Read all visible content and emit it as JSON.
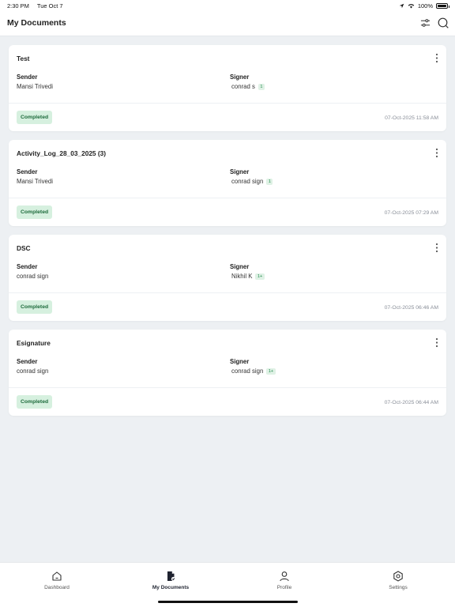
{
  "status_bar": {
    "time": "2:30 PM",
    "date": "Tue Oct 7",
    "battery": "100%"
  },
  "header": {
    "title": "My Documents",
    "filter_icon": "sliders-icon",
    "search_icon": "search-icon"
  },
  "labels": {
    "sender": "Sender",
    "signer": "Signer"
  },
  "documents": [
    {
      "title": "Test",
      "sender": "Mansi Trivedi",
      "signer": "conrad s",
      "signer_count": "1",
      "status": "Completed",
      "timestamp": "07-Oct-2025 11:58 AM"
    },
    {
      "title": "Activity_Log_28_03_2025 (3)",
      "sender": "Mansi Trivedi",
      "signer": "conrad sign",
      "signer_count": "1",
      "status": "Completed",
      "timestamp": "07-Oct-2025 07:29 AM"
    },
    {
      "title": "DSC",
      "sender": "conrad sign",
      "signer": "Nikhil K",
      "signer_count": "1+",
      "status": "Completed",
      "timestamp": "07-Oct-2025 06:46 AM"
    },
    {
      "title": "Esignature",
      "sender": "conrad sign",
      "signer": "conrad sign",
      "signer_count": "1+",
      "status": "Completed",
      "timestamp": "07-Oct-2025 06:44 AM"
    }
  ],
  "tabs": [
    {
      "label": "Dashboard",
      "icon": "home-icon",
      "active": false
    },
    {
      "label": "My Documents",
      "icon": "document-icon",
      "active": true
    },
    {
      "label": "Profile",
      "icon": "user-icon",
      "active": false
    },
    {
      "label": "Settings",
      "icon": "settings-icon",
      "active": false
    }
  ],
  "colors": {
    "status_badge_bg": "#d6f0df",
    "status_badge_text": "#1e6b3c",
    "background": "#edf0f3"
  }
}
